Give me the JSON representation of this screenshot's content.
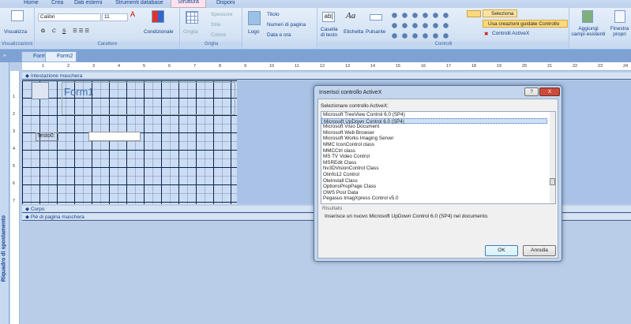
{
  "ribbon_tabs": [
    "Home",
    "Crea",
    "Dati esterni",
    "Strumenti database",
    "Struttura",
    "Disponi"
  ],
  "active_tab": "Struttura",
  "ribbon": {
    "visualizzazioni": {
      "button": "Visualizza",
      "label": "Visualizzazioni"
    },
    "carattere": {
      "font": "Calibri",
      "size": "11",
      "bold": "G",
      "italic": "C",
      "underline": "S",
      "conditional": "Condizionale",
      "label": "Carattere"
    },
    "griglia": {
      "grid": "Griglia",
      "thickness": "Spessore",
      "style": "Stile",
      "color": "Colore",
      "label": "Griglia"
    },
    "header": {
      "logo": "Logo",
      "title": "Titolo",
      "page_numbers": "Numeri di pagina",
      "date_time": "Data e ora"
    },
    "controlli": {
      "textbox": "Casella di testo",
      "label_ctrl": "Etichetta",
      "button": "Pulsante",
      "select": "Seleziona",
      "wizards": "Usa creazioni guidate Controllo",
      "activex": "Controlli ActiveX",
      "label": "Controlli"
    },
    "tools": {
      "add_fields": "Aggiungi campi esistenti",
      "props": "Finestra propri"
    }
  },
  "doc_tabs": [
    "Form1",
    "Form2"
  ],
  "nav_pane": "Riquadro di spostamento",
  "ruler": [
    "1",
    "2",
    "3",
    "4",
    "5",
    "6",
    "7",
    "8",
    "9",
    "10",
    "11",
    "12",
    "13",
    "14",
    "15",
    "16",
    "17",
    "18",
    "19",
    "20",
    "21",
    "22",
    "23",
    "24"
  ],
  "vruler": [
    "1",
    "2",
    "3",
    "4",
    "5",
    "6",
    "7"
  ],
  "form": {
    "header_section": "Intestazione maschera",
    "title": "Form1",
    "label": "Testo0:",
    "body_section": "Corpo",
    "footer_section": "Piè di pagina maschera"
  },
  "dialog": {
    "title": "Inserisci controllo ActiveX",
    "prompt": "Selezionare controllo ActiveX:",
    "items": [
      "Microsoft TreeView Control 6.0 (SP4)",
      "Microsoft UpDown Control 6.0 (SP4)",
      "Microsoft Visio Document",
      "Microsoft Web Browser",
      "Microsoft Works Imaging Server",
      "MMC IconControl class",
      "MMCCtrl class",
      "MS TV Video Control",
      "MSREdit Class",
      "Nv3DVisionControl Class",
      "OIinfo12 Control",
      "OleInstall Class",
      "OptionsPropPage Class",
      "OWS Post Data",
      "Pegasus ImagXpress Control v5.0"
    ],
    "selected_index": 1,
    "result_label": "Risultato",
    "result_text": "Inserisce un nuovo Microsoft UpDown Control 6.0 (SP4) nel documento.",
    "ok": "OK",
    "cancel": "Annulla",
    "help": "?",
    "close": "X"
  },
  "colors": {
    "ribbon": "#d3e2f4",
    "accent": "#15428b",
    "highlight": "#fcd97a",
    "grid_line": "#0c2347"
  }
}
